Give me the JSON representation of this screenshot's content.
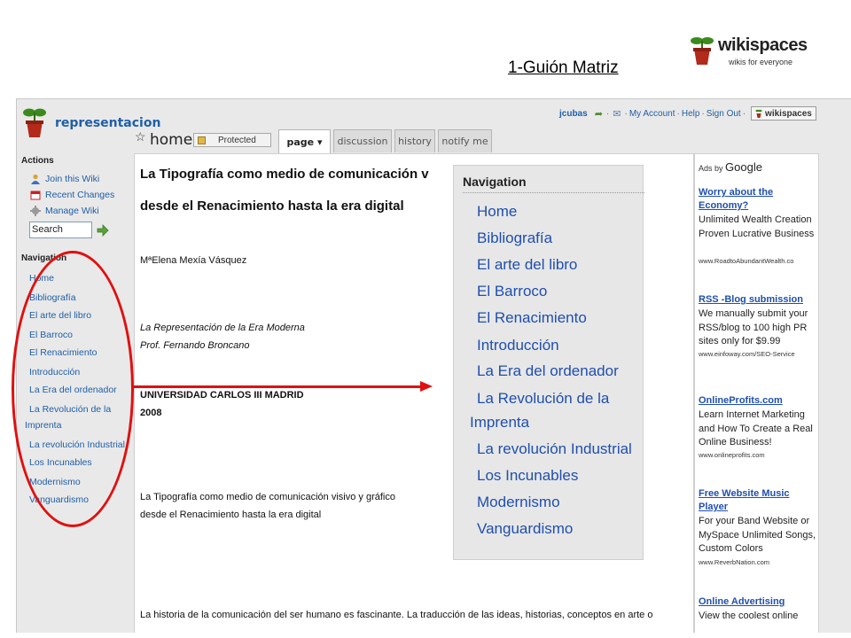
{
  "slide_title": "1-Guión Matriz",
  "brand": {
    "name": "wikispaces",
    "tagline": "wikis for everyone"
  },
  "wiki": {
    "name": "representacion"
  },
  "userbar": {
    "username": "jcubas",
    "links": [
      "My Account",
      "Help",
      "Sign Out"
    ],
    "brand_button": "wikispaces"
  },
  "page": {
    "title": "home",
    "protected_label": "Protected",
    "tabs": [
      {
        "label": "page ▾",
        "active": true
      },
      {
        "label": "discussion",
        "active": false
      },
      {
        "label": "history",
        "active": false
      },
      {
        "label": "notify me",
        "active": false
      }
    ]
  },
  "sidebar": {
    "actions_heading": "Actions",
    "actions": [
      {
        "label": "Join this Wiki",
        "icon": "user-icon"
      },
      {
        "label": "Recent Changes",
        "icon": "calendar-icon"
      },
      {
        "label": "Manage Wiki",
        "icon": "gear-icon"
      }
    ],
    "search_value": "Search",
    "navigation_heading": "Navigation",
    "nav": [
      "Home",
      "Bibliografía",
      "El arte del libro",
      "El Barroco",
      "El Renacimiento",
      "Introducción",
      "La Era del ordenador",
      "La Revolución de la",
      "Imprenta",
      "La revolución Industrial",
      "Los Incunables",
      "Modernismo",
      "Vanguardismo"
    ]
  },
  "content": {
    "title_line1": "La Tipografía como medio de comunicación v",
    "title_line2": "desde el Renacimiento hasta la era digital",
    "author": "MªElena Mexía Vásquez",
    "course_line1": "La Representación de la Era Moderna",
    "course_line2": "Prof. Fernando Broncano",
    "university": "UNIVERSIDAD CARLOS III MADRID",
    "year": "2008",
    "subtitle_line1": "La Tipografía como medio de comunicación visivo y gráfico",
    "subtitle_line2": "desde el Renacimiento hasta la era digital",
    "intro": "La historia de la comunicación del ser humano es fascinante. La traducción de las ideas, historias, conceptos en arte o"
  },
  "ads": {
    "label_prefix": "Ads by",
    "label_brand": "Google",
    "items": [
      {
        "title": "Worry about the Economy?",
        "body": "Unlimited Wealth Creation Proven Lucrative Business",
        "url": "www.RoadtoAbundantWealth.co"
      },
      {
        "title": "RSS -Blog submission",
        "body": "We manually submit your RSS/blog to 100 high PR sites only for $9.99",
        "url": "www.einfoway.com/SEO-Service"
      },
      {
        "title": "OnlineProfits.com",
        "body": "Learn Internet Marketing and How To Create a Real Online Business!",
        "url": "www.onlineprofits.com"
      },
      {
        "title": "Free Website Music Player",
        "body": "For your Band Website or MySpace Unlimited Songs, Custom Colors",
        "url": "www.ReverbNation.com"
      },
      {
        "title": "Online Advertising",
        "body": "View the coolest online",
        "url": ""
      }
    ]
  },
  "zoom": {
    "heading": "Navigation",
    "links": [
      "Home",
      "Bibliografía",
      "El arte del libro",
      "El Barroco",
      "El Renacimiento",
      "Introducción",
      "La Era del ordenador",
      "La Revolución de la",
      "Imprenta",
      "La revolución Industrial",
      "Los Incunables",
      "Modernismo",
      "Vanguardismo"
    ]
  },
  "colors": {
    "link": "#1f5fa8",
    "annotation": "#e01010",
    "sidebar_bg": "#e9e9e9"
  }
}
